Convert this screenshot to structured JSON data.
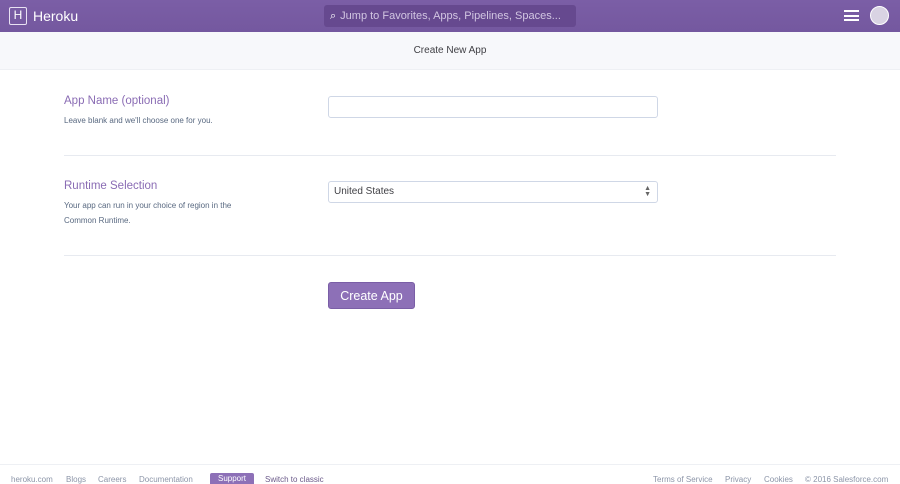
{
  "header": {
    "brand": "Heroku",
    "logo_letter": "H",
    "search_placeholder": "Jump to Favorites, Apps, Pipelines, Spaces..."
  },
  "subheader": {
    "title": "Create New App"
  },
  "form": {
    "app_name": {
      "label": "App Name (optional)",
      "description": "Leave blank and we'll choose one for you.",
      "value": ""
    },
    "runtime": {
      "label": "Runtime Selection",
      "description": "Your app can run in your choice of region in the Common Runtime.",
      "selected": "United States"
    },
    "submit": "Create App"
  },
  "footer": {
    "left": [
      "heroku.com",
      "Blogs",
      "Careers",
      "Documentation"
    ],
    "support": "Support",
    "switch": "Switch to classic",
    "right": [
      "Terms of Service",
      "Privacy",
      "Cookies",
      "© 2016 Salesforce.com"
    ]
  }
}
